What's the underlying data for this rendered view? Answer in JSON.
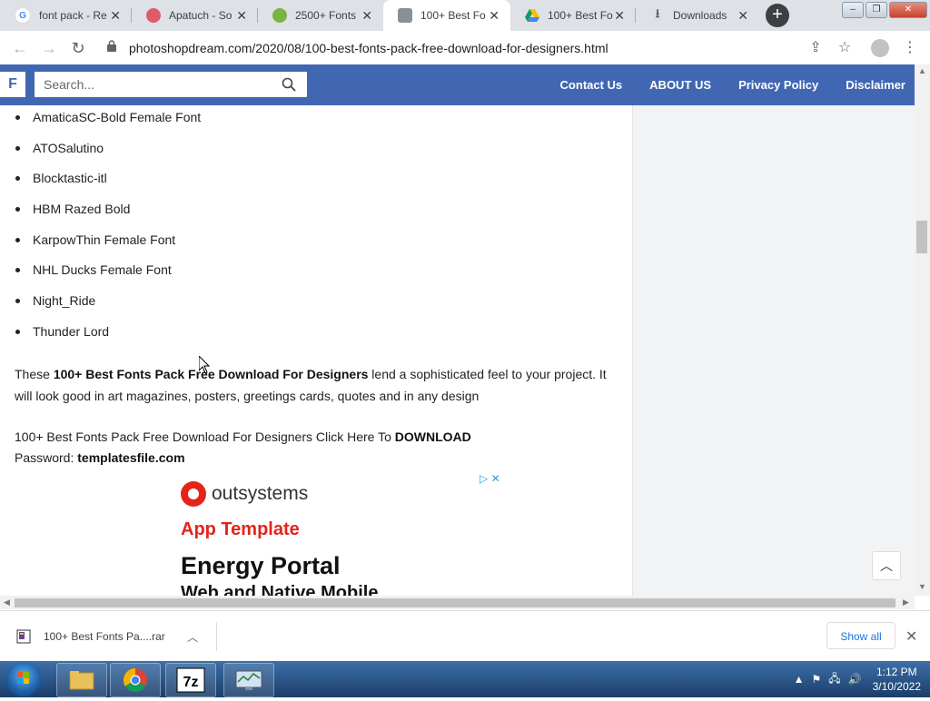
{
  "browser": {
    "tabs": [
      {
        "title": "font pack - Re",
        "icon": "google-icon",
        "color": "#4285f4"
      },
      {
        "title": "Apatuch - So",
        "icon": "apatuch-icon",
        "color": "#e05a6d"
      },
      {
        "title": "2500+ Fonts",
        "icon": "fonts-icon",
        "color": "#7cb342"
      },
      {
        "title": "100+ Best Fo",
        "icon": "site-icon",
        "color": "#8a8f99",
        "active": true
      },
      {
        "title": "100+ Best Fo",
        "icon": "google-drive-icon",
        "color": "#fbbc04"
      },
      {
        "title": "Downloads",
        "icon": "download-icon",
        "color": "#5f6368"
      }
    ],
    "url": "photoshopdream.com/2020/08/100-best-fonts-pack-free-download-for-designers.html"
  },
  "site": {
    "logo": "F",
    "search_placeholder": "Search...",
    "nav": [
      "Contact Us",
      "ABOUT US",
      "Privacy Policy",
      "Disclaimer"
    ]
  },
  "content": {
    "font_list": [
      "AmaticaSC-Bold Female Font",
      "ATOSalutino",
      "Blocktastic-itl",
      "HBM Razed Bold",
      "KarpowThin Female Font",
      "NHL Ducks Female Font",
      "Night_Ride",
      "Thunder Lord"
    ],
    "para1_prefix": "These ",
    "para1_bold": "100+ Best Fonts Pack Free Download For Designers",
    "para1_suffix": " lend a sophisticated feel to your project. It will look good in art magazines, posters, greetings cards, quotes and in any design",
    "download_text": "100+ Best Fonts Pack Free Download For Designers Click Here To ",
    "download_bold": "DOWNLOAD",
    "password_label": "Password: ",
    "password_value": "templatesfile.com"
  },
  "ad": {
    "brand": "outsystems",
    "subtitle": "App Template",
    "title": "Energy Portal",
    "tail": "Web and Native Mobile"
  },
  "downloads": {
    "file": "100+ Best Fonts Pa....rar",
    "show_all": "Show all"
  },
  "taskbar": {
    "time": "1:12 PM",
    "date": "3/10/2022"
  }
}
